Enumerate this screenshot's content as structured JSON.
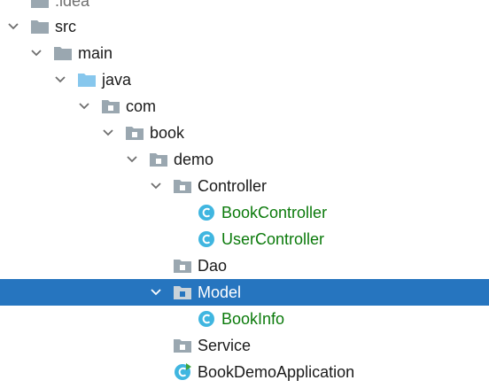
{
  "project_tree": {
    "items": [
      {
        "label": ".idea",
        "icon": "folder-icon",
        "expanded": false,
        "selected": false
      },
      {
        "label": "src",
        "icon": "folder-icon",
        "expanded": true,
        "selected": false
      },
      {
        "label": "main",
        "icon": "folder-icon",
        "expanded": true,
        "selected": false
      },
      {
        "label": "java",
        "icon": "source-root-folder-icon",
        "expanded": true,
        "selected": false
      },
      {
        "label": "com",
        "icon": "package-icon",
        "expanded": true,
        "selected": false
      },
      {
        "label": "book",
        "icon": "package-icon",
        "expanded": true,
        "selected": false
      },
      {
        "label": "demo",
        "icon": "package-icon",
        "expanded": true,
        "selected": false
      },
      {
        "label": "Controller",
        "icon": "package-icon",
        "expanded": true,
        "selected": false
      },
      {
        "label": "BookController",
        "icon": "java-class-icon",
        "selected": false
      },
      {
        "label": "UserController",
        "icon": "java-class-icon",
        "selected": false
      },
      {
        "label": "Dao",
        "icon": "package-icon",
        "expanded": false,
        "selected": false
      },
      {
        "label": "Model",
        "icon": "package-icon",
        "expanded": true,
        "selected": true
      },
      {
        "label": "BookInfo",
        "icon": "java-class-icon",
        "selected": false
      },
      {
        "label": "Service",
        "icon": "package-icon",
        "expanded": false,
        "selected": false
      },
      {
        "label": "BookDemoApplication",
        "icon": "spring-boot-class-icon",
        "selected": false
      }
    ]
  },
  "colors": {
    "selection": "#2675bf",
    "class_text": "#0b7a0b",
    "folder": "#9aa7b0",
    "source_root": "#87c7ed",
    "class_badge": "#40b6e0"
  }
}
